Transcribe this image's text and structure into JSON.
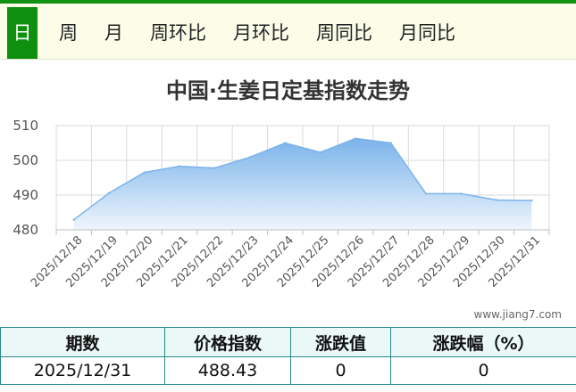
{
  "tabs": [
    {
      "label": "日",
      "active": true
    },
    {
      "label": "周",
      "active": false
    },
    {
      "label": "月",
      "active": false
    },
    {
      "label": "周环比",
      "active": false
    },
    {
      "label": "月环比",
      "active": false
    },
    {
      "label": "周同比",
      "active": false
    },
    {
      "label": "月同比",
      "active": false
    }
  ],
  "colors": {
    "accent": "#0e8f0e",
    "series_line": "#7bb3ea",
    "area_top": "#7bb3ea",
    "area_bottom": "#eef5fd"
  },
  "chart_data": {
    "type": "area",
    "title": "中国·生姜日定基指数走势",
    "xlabel": "",
    "ylabel": "",
    "ylim": [
      480,
      510
    ],
    "yticks": [
      "480",
      "490",
      "500",
      "510"
    ],
    "grid": true,
    "x": [
      "2025/12/18",
      "2025/12/19",
      "2025/12/20",
      "2025/12/21",
      "2025/12/22",
      "2025/12/23",
      "2025/12/24",
      "2025/12/25",
      "2025/12/26",
      "2025/12/27",
      "2025/12/28",
      "2025/12/29",
      "2025/12/30",
      "2025/12/31"
    ],
    "series": [
      {
        "values": [
          482.9,
          490.6,
          496.5,
          498.3,
          497.8,
          500.9,
          505.0,
          502.3,
          506.3,
          505.0,
          490.4,
          490.4,
          488.6,
          488.43
        ]
      }
    ]
  },
  "watermark": "www.jiang7.com",
  "table": {
    "headers": [
      "期数",
      "价格指数",
      "涨跌值",
      "涨跌幅（%）"
    ],
    "row": [
      "2025/12/31",
      "488.43",
      "0",
      "0"
    ]
  }
}
